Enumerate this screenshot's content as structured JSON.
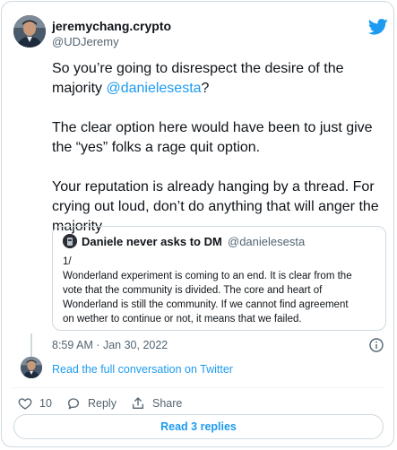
{
  "author": {
    "name": "jeremychang.crypto",
    "handle": "@UDJeremy"
  },
  "tweet": {
    "p1_text": "So you’re going to disrespect the desire of the majority ",
    "p1_mention": "@danielesesta",
    "p1_end": "?",
    "p2": "The clear option here would have been to just give the “yes” folks a rage quit option.",
    "p3": "Your reputation is already hanging by a thread. For crying out loud, don’t do anything that will anger the majority"
  },
  "quote": {
    "name": "Daniele never asks to DM",
    "handle": "@danielesesta",
    "lines": [
      "1/",
      "Wonderland experiment is coming to an end. It is clear from the",
      "vote that the community is divided. The core and heart of",
      "Wonderland is still the community. If we cannot find agreement",
      "on wether to continue or not, it means that we failed."
    ]
  },
  "timestamp": "8:59 AM · Jan 30, 2022",
  "conversation_link": "Read the full conversation on Twitter",
  "actions": {
    "like_count": "10",
    "reply_label": "Reply",
    "share_label": "Share"
  },
  "replies_button": "Read 3 replies",
  "colors": {
    "accent": "#1d9bf0",
    "text": "#0f1419",
    "secondary": "#536471",
    "border": "#cfd9de"
  }
}
